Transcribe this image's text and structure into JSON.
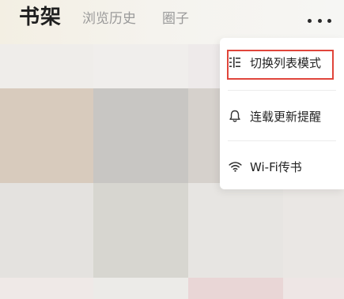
{
  "header": {
    "tabs": [
      {
        "label": "书架",
        "active": true
      },
      {
        "label": "浏览历史",
        "active": false
      },
      {
        "label": "圈子",
        "active": false
      }
    ],
    "more_icon": "more-dots-icon"
  },
  "menu": {
    "items": [
      {
        "label": "切换列表模式",
        "icon": "list-icon",
        "highlighted": true
      },
      {
        "label": "连载更新提醒",
        "icon": "bell-icon",
        "highlighted": false
      },
      {
        "label": "Wi-Fi传书",
        "icon": "wifi-icon",
        "highlighted": false
      }
    ],
    "highlight_color": "#e0453b"
  },
  "colors": {
    "active_tab": "#1f1f1f",
    "inactive_tab": "#9a9a9a"
  }
}
